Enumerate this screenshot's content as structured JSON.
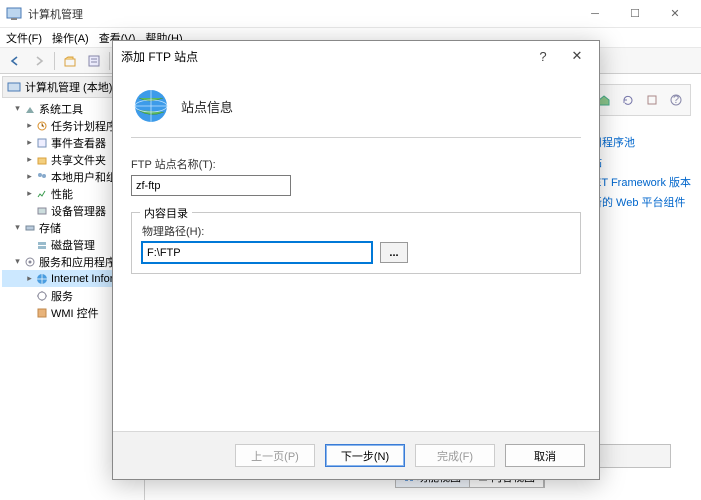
{
  "window": {
    "title": "计算机管理"
  },
  "menu": {
    "file": "文件(F)",
    "action": "操作(A)",
    "view": "查看(V)",
    "help": "帮助(H)"
  },
  "tree": {
    "root": "计算机管理 (本地)",
    "sys_tools": "系统工具",
    "task_scheduler": "任务计划程序",
    "event_viewer": "事件查看器",
    "shared_folders": "共享文件夹",
    "local_users": "本地用户和组",
    "performance": "性能",
    "device_mgr": "设备管理器",
    "storage": "存储",
    "disk_mgmt": "磁盘管理",
    "services_apps": "服务和应用程序",
    "iis": "Internet Informa",
    "services": "服务",
    "wmi": "WMI 控件"
  },
  "actions": {
    "app_pools": "看应用程序池",
    "websites": "看网站",
    "dotnet": "改 .NET Framework 版本",
    "webplatform": "获取新的 Web 平台组件"
  },
  "tabs": {
    "func": "功能视图",
    "content": "内容视图"
  },
  "dialog": {
    "title": "添加 FTP 站点",
    "heading": "站点信息",
    "site_name_label": "FTP 站点名称(T):",
    "site_name_value": "zf-ftp",
    "content_group": "内容目录",
    "path_label": "物理路径(H):",
    "path_value": "F:\\FTP",
    "browse": "...",
    "prev": "上一页(P)",
    "next": "下一步(N)",
    "finish": "完成(F)",
    "cancel": "取消"
  }
}
